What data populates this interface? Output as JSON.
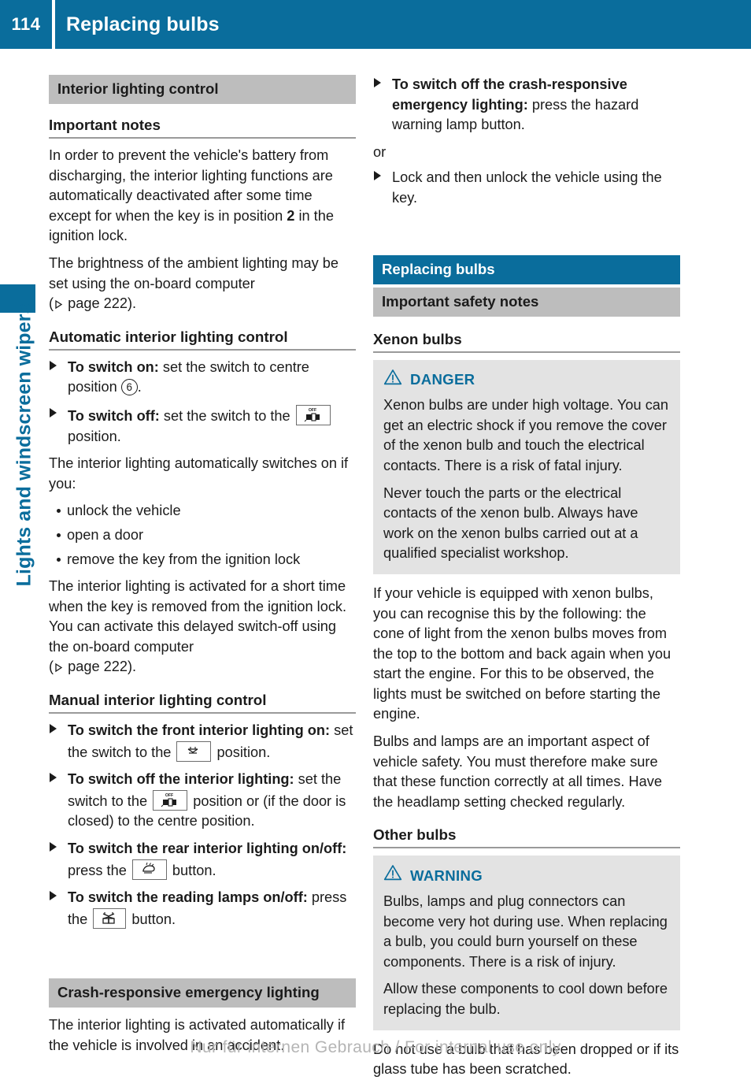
{
  "header": {
    "page_number": "114",
    "title": "Replacing bulbs"
  },
  "sidebar": {
    "chapter_label": "Lights and windscreen wipers",
    "accent_color": "#0a6d9c"
  },
  "colors": {
    "accent": "#0a6d9c",
    "banner_grey": "#bdbdbd",
    "warnbox_grey": "#e3e3e3",
    "rule_grey": "#9a9a9a",
    "text": "#1b1b1b"
  },
  "left_column": {
    "section_banner": "Interior lighting control",
    "important_notes": {
      "heading": "Important notes",
      "paragraph_1_a": "In order to prevent the vehicle's battery from discharging, the interior lighting functions are automatically deactivated after some time except for when the key is in position ",
      "paragraph_1_bold": "2",
      "paragraph_1_b": " in the ignition lock.",
      "paragraph_2_a": "The brightness of the ambient lighting may be set using the on-board computer",
      "paragraph_2_ref": "page 222"
    },
    "automatic_control": {
      "heading": "Automatic interior lighting control",
      "step_1_bold": "To switch on:",
      "step_1_text": " set the switch to centre position ",
      "step_1_circled": "6",
      "step_1_tail": ".",
      "step_2_bold": "To switch off:",
      "step_2_text": " set the switch to the ",
      "step_2_tail": " position.",
      "intro": "The interior lighting automatically switches on if you:",
      "bullets": [
        "unlock the vehicle",
        "open a door",
        "remove the key from the ignition lock"
      ],
      "closing_a": "The interior lighting is activated for a short time when the key is removed from the ignition lock. You can activate this delayed switch-off using the on-board computer",
      "closing_ref": "page 222"
    },
    "manual_control": {
      "heading": "Manual interior lighting control",
      "step_1_bold": "To switch the front interior lighting on:",
      "step_1_text": " set the switch to the ",
      "step_1_tail": " position.",
      "step_2_bold": "To switch off the interior lighting:",
      "step_2_text": " set the switch to the ",
      "step_2_tail": " position or (if the door is closed) to the centre position.",
      "step_3_bold": "To switch the rear interior lighting on/off:",
      "step_3_text": " press the ",
      "step_3_tail": " button.",
      "step_4_bold": "To switch the reading lamps on/off:",
      "step_4_text": " press the ",
      "step_4_tail": " button."
    },
    "crash_emergency": {
      "banner": "Crash-responsive emergency lighting",
      "paragraph": "The interior lighting is activated automatically if the vehicle is involved in an accident."
    }
  },
  "right_column": {
    "step_1_bold": "To switch off the crash-responsive emergency lighting:",
    "step_1_text": " press the hazard warning lamp button.",
    "or_label": "or",
    "step_2_text": "Lock and then unlock the vehicle using the key.",
    "replacing_bulbs": {
      "banner_blue": "Replacing bulbs",
      "banner_grey": "Important safety notes",
      "xenon": {
        "heading": "Xenon bulbs",
        "warning_level": "DANGER",
        "paragraph_1": "Xenon bulbs are under high voltage. You can get an electric shock if you remove the cover of the xenon bulb and touch the electrical contacts. There is a risk of fatal injury.",
        "paragraph_2": "Never touch the parts or the electrical contacts of the xenon bulb. Always have work on the xenon bulbs carried out at a qualified specialist workshop."
      },
      "body_paragraph_1": "If your vehicle is equipped with xenon bulbs, you can recognise this by the following: the cone of light from the xenon bulbs moves from the top to the bottom and back again when you start the engine. For this to be observed, the lights must be switched on before starting the engine.",
      "body_paragraph_2": "Bulbs and lamps are an important aspect of vehicle safety. You must therefore make sure that these function correctly at all times. Have the headlamp setting checked regularly.",
      "other": {
        "heading": "Other bulbs",
        "warning_level": "WARNING",
        "paragraph_1": "Bulbs, lamps and plug connectors can become very hot during use. When replacing a bulb, you could burn yourself on these components. There is a risk of injury.",
        "paragraph_2": "Allow these components to cool down before replacing the bulb."
      },
      "closing_paragraph": "Do not use a bulb that has been dropped or if its glass tube has been scratched."
    }
  },
  "footer": {
    "text": "Nur für internen Gebrauch / For internal use only"
  }
}
